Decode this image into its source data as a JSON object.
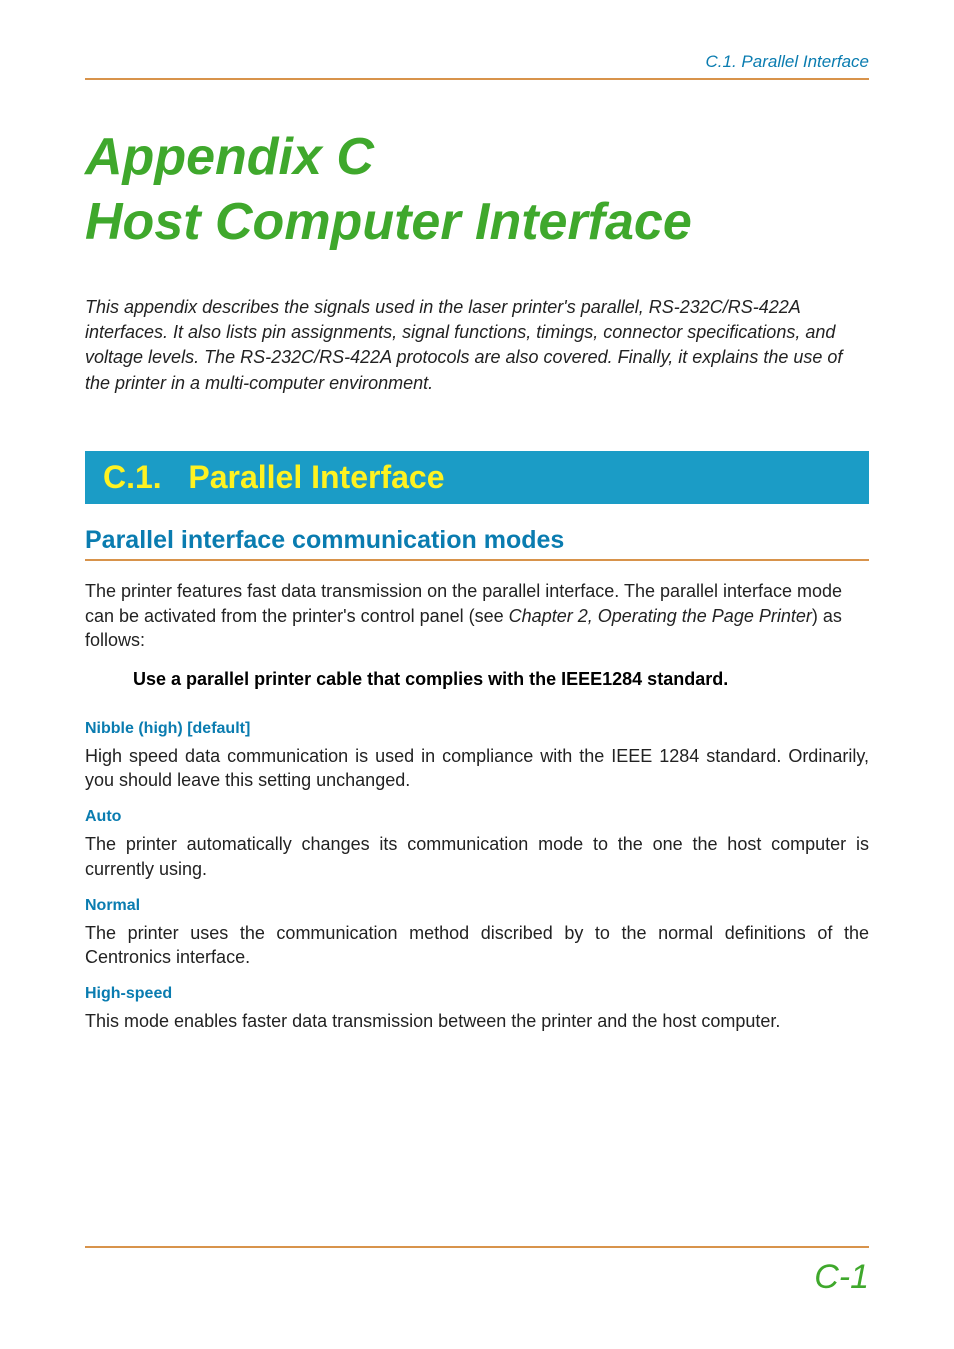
{
  "header": {
    "running_head": "C.1. Parallel Interface"
  },
  "title": {
    "line1": "Appendix C",
    "line2": "Host Computer Interface"
  },
  "intro": "This appendix describes the signals used in the laser printer's parallel, RS-232C/RS-422A interfaces. It also lists pin assignments, signal functions, timings, connector specifications, and voltage levels. The RS-232C/RS-422A protocols are also covered. Finally, it explains the use of the printer in a multi-computer environment.",
  "section": {
    "number_label": "C.1.",
    "title": "Parallel Interface"
  },
  "subsection": {
    "title": "Parallel interface communication modes",
    "para_before": "The printer features fast data transmission on the parallel interface. The parallel interface mode can be activated from the printer's control panel (see ",
    "para_ital": "Chapter 2, Operating the Page Printer",
    "para_after": ") as follows:",
    "note": "Use a parallel printer cable that complies with the IEEE1284 standard."
  },
  "modes": [
    {
      "title": "Nibble (high) [default]",
      "desc": "High speed data communication is used in compliance with the IEEE 1284 standard. Ordinarily, you should leave this setting unchanged."
    },
    {
      "title": "Auto",
      "desc": "The printer automatically changes its communication mode to the one the host computer is currently using."
    },
    {
      "title": "Normal",
      "desc": "The printer uses the communication method discribed by to the normal definitions of the Centronics interface."
    },
    {
      "title": "High-speed",
      "desc": "This mode enables faster data transmission between the printer and the host computer."
    }
  ],
  "footer": {
    "page": "C-1"
  }
}
